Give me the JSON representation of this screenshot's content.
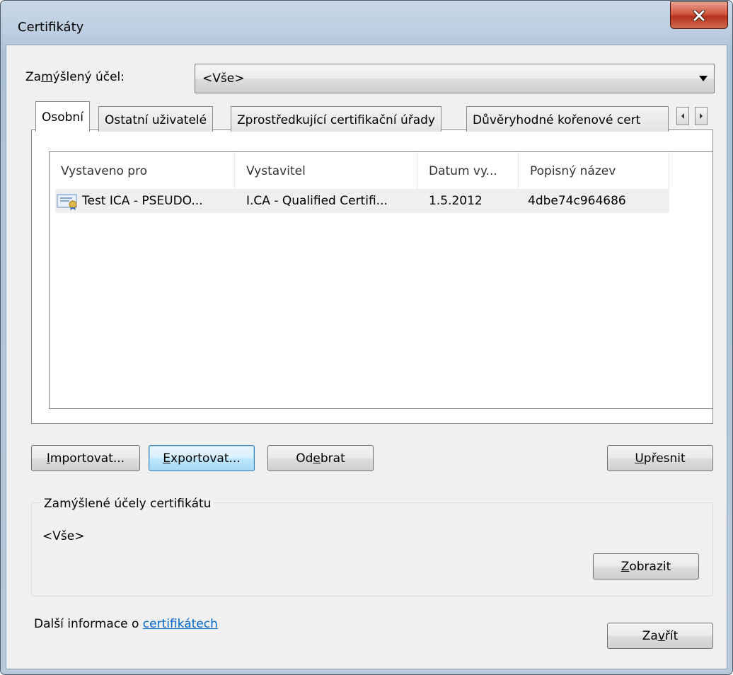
{
  "window": {
    "title": "Certifikáty"
  },
  "purpose": {
    "label_pre": "Za",
    "label_key": "m",
    "label_post": "ýšlený účel:",
    "selected": "<Vše>"
  },
  "tabs": [
    {
      "label": "Osobní"
    },
    {
      "label": "Ostatní uživatelé"
    },
    {
      "label": "Zprostředkující certifikační úřady"
    },
    {
      "label": "Důvěryhodné kořenové cert"
    }
  ],
  "table": {
    "columns": [
      "Vystaveno pro",
      "Vystavitel",
      "Datum vy...",
      "Popisný název"
    ],
    "rows": [
      {
        "issued_to": "Test ICA - PSEUDO...",
        "issuer": "I.CA - Qualified Certifi...",
        "date": "1.5.2012",
        "friendly_name": "4dbe74c964686",
        "icon": "certificate-icon"
      }
    ]
  },
  "buttons": {
    "import": {
      "key": "I",
      "rest": "mportovat..."
    },
    "export": {
      "key": "E",
      "rest": "xportovat..."
    },
    "remove": {
      "pre": "Od",
      "key": "e",
      "rest": "brat"
    },
    "advanced": {
      "key": "U",
      "rest": "přesnit"
    },
    "view": {
      "key": "Z",
      "rest": "obrazit"
    },
    "close": {
      "pre": "Za",
      "key": "v",
      "rest": "řít"
    }
  },
  "purposes_group": {
    "title": "Zamýšlené účely certifikátu",
    "value": "<Vše>"
  },
  "footer": {
    "text": "Další informace o ",
    "link": "certifikátech"
  },
  "colors": {
    "close_button": "#c8442c",
    "link": "#0066cc",
    "tab_panel": "#ffffff"
  }
}
